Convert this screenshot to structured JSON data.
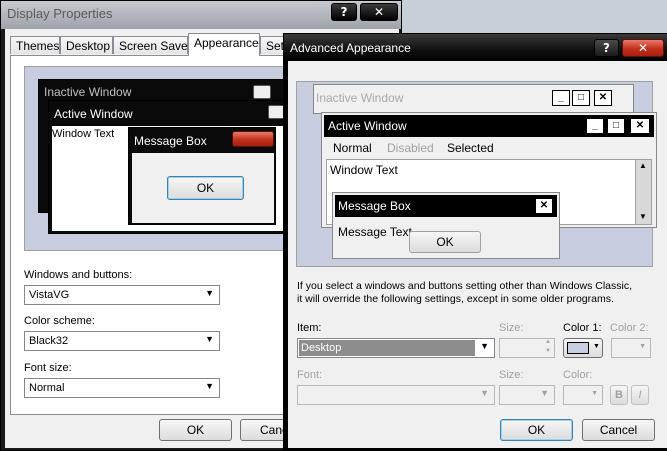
{
  "display_props": {
    "title": "Display Properties",
    "tabs": [
      "Themes",
      "Desktop",
      "Screen Saver",
      "Appearance",
      "Setti"
    ],
    "preview": {
      "inactive_title": "Inactive Window",
      "active_title": "Active Window",
      "window_text": "Window Text",
      "msgbox_title": "Message Box",
      "ok_label": "OK"
    },
    "windows_buttons_label": "Windows and buttons:",
    "windows_buttons_value": "VistaVG",
    "color_scheme_label": "Color scheme:",
    "color_scheme_value": "Black32",
    "font_size_label": "Font size:",
    "font_size_value": "Normal",
    "ok_label": "OK",
    "cancel_label": "Canc"
  },
  "advanced": {
    "title": "Advanced Appearance",
    "preview": {
      "inactive_title": "Inactive Window",
      "active_title": "Active Window",
      "menu_normal": "Normal",
      "menu_disabled": "Disabled",
      "menu_selected": "Selected",
      "window_text": "Window Text",
      "msgbox_title": "Message Box",
      "msgbox_text": "Message Text",
      "ok_label": "OK"
    },
    "info_text_1": "If you select a windows and buttons setting other than Windows Classic,",
    "info_text_2": "it will override the following settings, except in some older programs.",
    "item_label": "Item:",
    "item_value": "Desktop",
    "size_label": "Size:",
    "color1_label": "Color 1:",
    "color2_label": "Color 2:",
    "font_label": "Font:",
    "font_size_label": "Size:",
    "font_color_label": "Color:",
    "bold_label": "B",
    "italic_label": "I",
    "ok_label": "OK",
    "cancel_label": "Cancel",
    "color1_swatch": "#c8cfe0"
  },
  "icons": {
    "help": "?",
    "close": "✕",
    "minimize": "_",
    "maximize": "□",
    "dropdown": "▼",
    "scroll_up": "▲",
    "scroll_down": "▼"
  }
}
